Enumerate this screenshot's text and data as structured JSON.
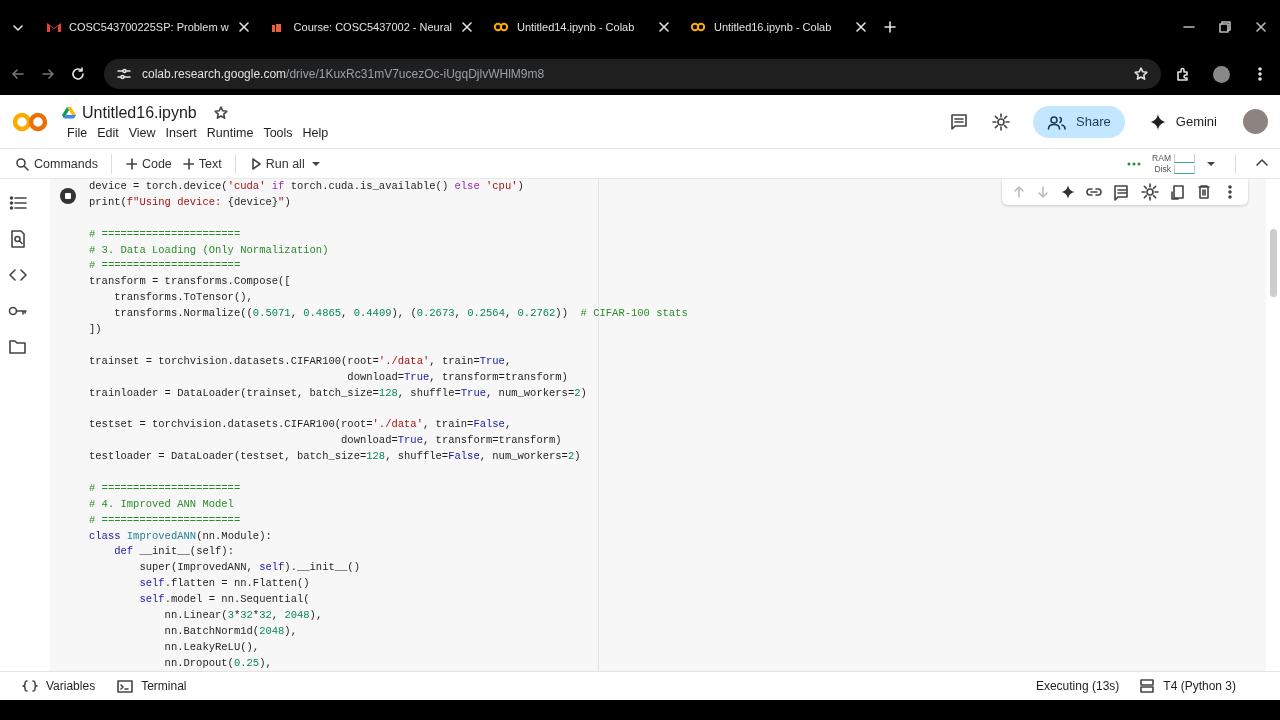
{
  "browser": {
    "tabs": [
      {
        "title": "COSC543700225SP: Problem w",
        "kind": "mail"
      },
      {
        "title": "Course: COSC5437002 - Neural",
        "kind": "course"
      },
      {
        "title": "Untitled14.ipynb - Colab",
        "kind": "colab"
      },
      {
        "title": "Untitled16.ipynb - Colab",
        "kind": "colab"
      }
    ],
    "url_host": "colab.research.google.com",
    "url_path": "/drive/1KuxRc31mV7ucezOc-iUgqDjlvWHlM9m8"
  },
  "notebook": {
    "title": "Untitled16.ipynb",
    "menu": [
      "File",
      "Edit",
      "View",
      "Insert",
      "Runtime",
      "Tools",
      "Help"
    ],
    "share": "Share",
    "gemini": "Gemini"
  },
  "toolbar": {
    "commands": "Commands",
    "add_code": "Code",
    "add_text": "Text",
    "run_all": "Run all",
    "ram": "RAM",
    "disk": "Disk"
  },
  "cell": {
    "running": true,
    "lines": [
      {
        "kind": "code",
        "segments": [
          {
            "kind": "plain",
            "text": "device = torch.device("
          },
          {
            "kind": "string",
            "text": "'cuda'"
          },
          {
            "kind": "control",
            "text": " if "
          },
          {
            "kind": "plain",
            "text": "torch.cuda.is_available() "
          },
          {
            "kind": "control",
            "text": "else "
          },
          {
            "kind": "string",
            "text": "'cpu'"
          },
          {
            "kind": "plain",
            "text": ")"
          }
        ]
      },
      {
        "kind": "code",
        "segments": [
          {
            "kind": "plain",
            "text": "print("
          },
          {
            "kind": "string",
            "text": "f\"Using device: "
          },
          {
            "kind": "plain",
            "text": "{device}"
          },
          {
            "kind": "string",
            "text": "\""
          },
          {
            "kind": "plain",
            "text": ")"
          }
        ]
      },
      {
        "kind": "blank"
      },
      {
        "kind": "code",
        "segments": [
          {
            "kind": "comment",
            "text": "# ======================"
          }
        ]
      },
      {
        "kind": "code",
        "segments": [
          {
            "kind": "comment",
            "text": "# 3. Data Loading (Only Normalization)"
          }
        ]
      },
      {
        "kind": "code",
        "segments": [
          {
            "kind": "comment",
            "text": "# ======================"
          }
        ]
      },
      {
        "kind": "code",
        "segments": [
          {
            "kind": "plain",
            "text": "transform = transforms.Compose(["
          }
        ]
      },
      {
        "kind": "code",
        "segments": [
          {
            "kind": "plain",
            "text": "    transforms.ToTensor(),"
          }
        ]
      },
      {
        "kind": "code",
        "segments": [
          {
            "kind": "plain",
            "text": "    transforms.Normalize(("
          },
          {
            "kind": "number",
            "text": "0.5071"
          },
          {
            "kind": "plain",
            "text": ", "
          },
          {
            "kind": "number",
            "text": "0.4865"
          },
          {
            "kind": "plain",
            "text": ", "
          },
          {
            "kind": "number",
            "text": "0.4409"
          },
          {
            "kind": "plain",
            "text": "), ("
          },
          {
            "kind": "number",
            "text": "0.2673"
          },
          {
            "kind": "plain",
            "text": ", "
          },
          {
            "kind": "number",
            "text": "0.2564"
          },
          {
            "kind": "plain",
            "text": ", "
          },
          {
            "kind": "number",
            "text": "0.2762"
          },
          {
            "kind": "plain",
            "text": "))  "
          },
          {
            "kind": "comment",
            "text": "# CIFAR-100 stats"
          }
        ]
      },
      {
        "kind": "code",
        "segments": [
          {
            "kind": "plain",
            "text": "])"
          }
        ]
      },
      {
        "kind": "blank"
      },
      {
        "kind": "code",
        "segments": [
          {
            "kind": "plain",
            "text": "trainset = torchvision.datasets.CIFAR100(root="
          },
          {
            "kind": "string",
            "text": "'./data'"
          },
          {
            "kind": "plain",
            "text": ", train="
          },
          {
            "kind": "keyword",
            "text": "True"
          },
          {
            "kind": "plain",
            "text": ","
          }
        ]
      },
      {
        "kind": "code",
        "segments": [
          {
            "kind": "plain",
            "text": "                                         download="
          },
          {
            "kind": "keyword",
            "text": "True"
          },
          {
            "kind": "plain",
            "text": ", transform=transform)"
          }
        ]
      },
      {
        "kind": "code",
        "segments": [
          {
            "kind": "plain",
            "text": "trainloader = DataLoader(trainset, batch_size="
          },
          {
            "kind": "number",
            "text": "128"
          },
          {
            "kind": "plain",
            "text": ", shuffle="
          },
          {
            "kind": "keyword",
            "text": "True"
          },
          {
            "kind": "plain",
            "text": ", num_workers="
          },
          {
            "kind": "number",
            "text": "2"
          },
          {
            "kind": "plain",
            "text": ")"
          }
        ]
      },
      {
        "kind": "blank"
      },
      {
        "kind": "code",
        "segments": [
          {
            "kind": "plain",
            "text": "testset = torchvision.datasets.CIFAR100(root="
          },
          {
            "kind": "string",
            "text": "'./data'"
          },
          {
            "kind": "plain",
            "text": ", train="
          },
          {
            "kind": "keyword",
            "text": "False"
          },
          {
            "kind": "plain",
            "text": ","
          }
        ]
      },
      {
        "kind": "code",
        "segments": [
          {
            "kind": "plain",
            "text": "                                        download="
          },
          {
            "kind": "keyword",
            "text": "True"
          },
          {
            "kind": "plain",
            "text": ", transform=transform)"
          }
        ]
      },
      {
        "kind": "code",
        "segments": [
          {
            "kind": "plain",
            "text": "testloader = DataLoader(testset, batch_size="
          },
          {
            "kind": "number",
            "text": "128"
          },
          {
            "kind": "plain",
            "text": ", shuffle="
          },
          {
            "kind": "keyword",
            "text": "False"
          },
          {
            "kind": "plain",
            "text": ", num_workers="
          },
          {
            "kind": "number",
            "text": "2"
          },
          {
            "kind": "plain",
            "text": ")"
          }
        ]
      },
      {
        "kind": "blank"
      },
      {
        "kind": "code",
        "segments": [
          {
            "kind": "comment",
            "text": "# ======================"
          }
        ]
      },
      {
        "kind": "code",
        "segments": [
          {
            "kind": "comment",
            "text": "# 4. Improved ANN Model"
          }
        ]
      },
      {
        "kind": "code",
        "segments": [
          {
            "kind": "comment",
            "text": "# ======================"
          }
        ]
      },
      {
        "kind": "code",
        "segments": [
          {
            "kind": "keyword",
            "text": "class "
          },
          {
            "kind": "type",
            "text": "ImprovedANN"
          },
          {
            "kind": "plain",
            "text": "(nn.Module):"
          }
        ]
      },
      {
        "kind": "code",
        "segments": [
          {
            "kind": "keyword",
            "text": "    def "
          },
          {
            "kind": "plain",
            "text": "__init__(self):"
          }
        ]
      },
      {
        "kind": "code",
        "segments": [
          {
            "kind": "plain",
            "text": "        super(ImprovedANN, "
          },
          {
            "kind": "keyword",
            "text": "self"
          },
          {
            "kind": "plain",
            "text": ").__init__()"
          }
        ]
      },
      {
        "kind": "code",
        "segments": [
          {
            "kind": "keyword",
            "text": "        self"
          },
          {
            "kind": "plain",
            "text": ".flatten = nn.Flatten()"
          }
        ]
      },
      {
        "kind": "code",
        "segments": [
          {
            "kind": "keyword",
            "text": "        self"
          },
          {
            "kind": "plain",
            "text": ".model = nn.Sequential("
          }
        ]
      },
      {
        "kind": "code",
        "segments": [
          {
            "kind": "plain",
            "text": "            nn.Linear("
          },
          {
            "kind": "number",
            "text": "3"
          },
          {
            "kind": "plain",
            "text": "*"
          },
          {
            "kind": "number",
            "text": "32"
          },
          {
            "kind": "plain",
            "text": "*"
          },
          {
            "kind": "number",
            "text": "32"
          },
          {
            "kind": "plain",
            "text": ", "
          },
          {
            "kind": "number",
            "text": "2048"
          },
          {
            "kind": "plain",
            "text": "),"
          }
        ]
      },
      {
        "kind": "code",
        "segments": [
          {
            "kind": "plain",
            "text": "            nn.BatchNorm1d("
          },
          {
            "kind": "number",
            "text": "2048"
          },
          {
            "kind": "plain",
            "text": "),"
          }
        ]
      },
      {
        "kind": "code",
        "segments": [
          {
            "kind": "plain",
            "text": "            nn.LeakyReLU(),"
          }
        ]
      },
      {
        "kind": "code",
        "segments": [
          {
            "kind": "plain",
            "text": "            nn.Dropout("
          },
          {
            "kind": "number",
            "text": "0.25"
          },
          {
            "kind": "plain",
            "text": "),"
          }
        ]
      }
    ]
  },
  "status_bar": {
    "variables": "Variables",
    "terminal": "Terminal",
    "execution": "Executing (13s)",
    "runtime": "T4 (Python 3)"
  }
}
